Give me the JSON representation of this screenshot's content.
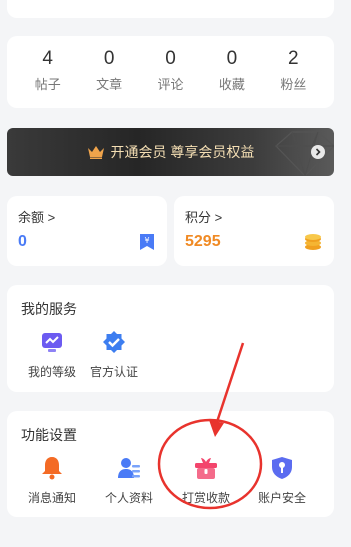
{
  "stats": [
    {
      "value": "4",
      "label": "帖子"
    },
    {
      "value": "0",
      "label": "文章"
    },
    {
      "value": "0",
      "label": "评论"
    },
    {
      "value": "0",
      "label": "收藏"
    },
    {
      "value": "2",
      "label": "粉丝"
    }
  ],
  "vip_banner": {
    "text": "开通会员 尊享会员权益",
    "text_color": "#f5dfb4",
    "icon": "crown-icon"
  },
  "wallet": {
    "balance": {
      "title": "余额 >",
      "value": "0",
      "value_color": "#4a7bf6",
      "icon": "yuan-tag-icon"
    },
    "points": {
      "title": "积分 >",
      "value": "5295",
      "value_color": "#f08a24",
      "icon": "coin-stack-icon"
    }
  },
  "services": {
    "title": "我的服务",
    "items": [
      {
        "label": "我的等级",
        "icon": "level-chart-icon"
      },
      {
        "label": "官方认证",
        "icon": "verified-badge-icon"
      }
    ]
  },
  "settings": {
    "title": "功能设置",
    "items": [
      {
        "label": "消息通知",
        "icon": "bell-icon"
      },
      {
        "label": "个人资料",
        "icon": "profile-card-icon"
      },
      {
        "label": "打赏收款",
        "icon": "gift-icon"
      },
      {
        "label": "账户安全",
        "icon": "shield-key-icon"
      }
    ]
  },
  "colors": {
    "background": "#f4f5f7",
    "annotation": "#e8332d",
    "accent_blue": "#4a7bf6",
    "accent_orange": "#f08a24"
  }
}
